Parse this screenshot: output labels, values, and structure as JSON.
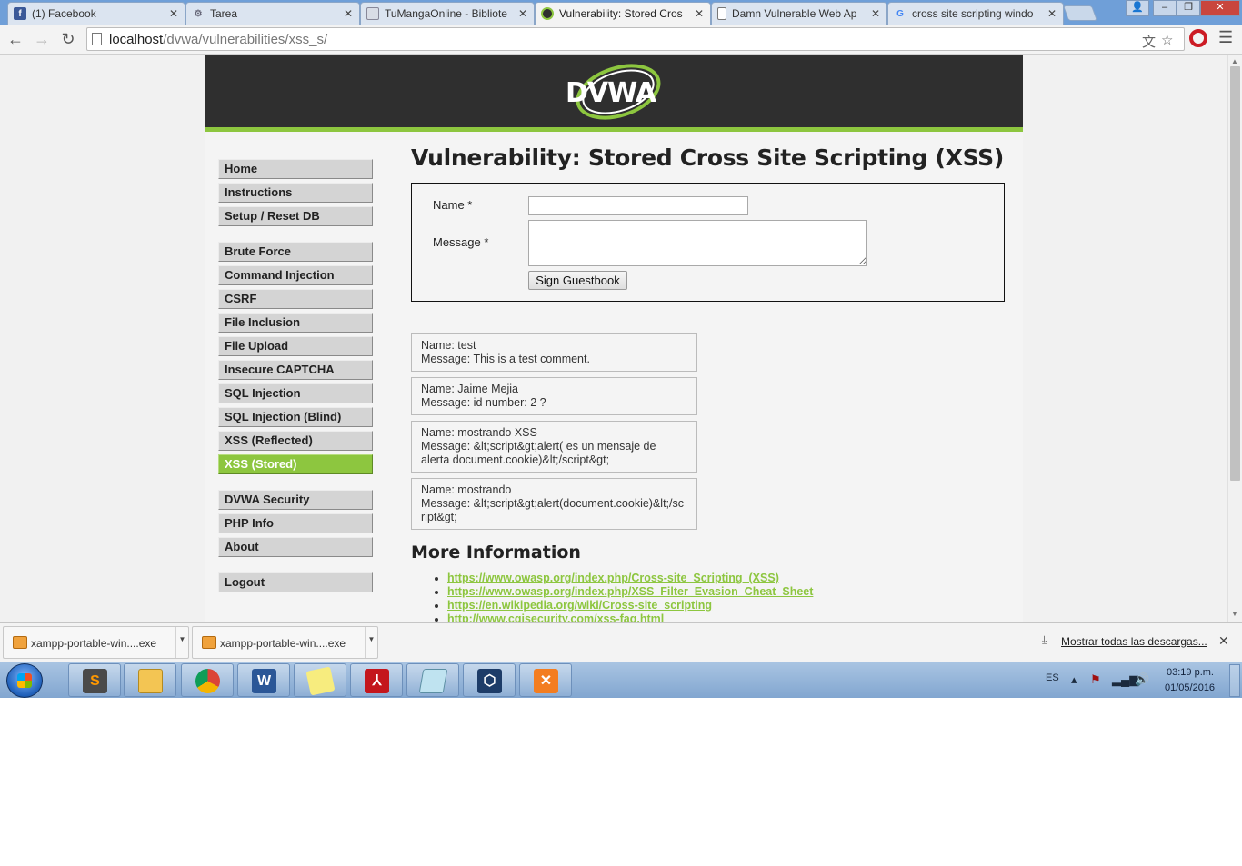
{
  "browser": {
    "tabs": [
      {
        "title": "(1) Facebook",
        "active": false,
        "favicon": "facebook-icon"
      },
      {
        "title": "Tarea",
        "active": false,
        "favicon": "gear-icon"
      },
      {
        "title": "TuMangaOnline - Bibliote",
        "active": false,
        "favicon": "manga-icon"
      },
      {
        "title": "Vulnerability: Stored Cros",
        "active": true,
        "favicon": "dvwa-icon"
      },
      {
        "title": "Damn Vulnerable Web Ap",
        "active": false,
        "favicon": "page-icon"
      },
      {
        "title": "cross site scripting windo",
        "active": false,
        "favicon": "google-icon"
      }
    ],
    "url_host": "localhost",
    "url_path": "/dvwa/vulnerabilities/xss_s/"
  },
  "dvwa": {
    "logo_text": "DVWA",
    "menu": {
      "block1": [
        "Home",
        "Instructions",
        "Setup / Reset DB"
      ],
      "block2": [
        "Brute Force",
        "Command Injection",
        "CSRF",
        "File Inclusion",
        "File Upload",
        "Insecure CAPTCHA",
        "SQL Injection",
        "SQL Injection (Blind)",
        "XSS (Reflected)",
        "XSS (Stored)"
      ],
      "block3": [
        "DVWA Security",
        "PHP Info",
        "About"
      ],
      "block4": [
        "Logout"
      ],
      "selected": "XSS (Stored)"
    },
    "title": "Vulnerability: Stored Cross Site Scripting (XSS)",
    "form": {
      "name_label": "Name *",
      "message_label": "Message *",
      "name_value": "",
      "message_value": "",
      "button_label": "Sign Guestbook"
    },
    "entries": [
      {
        "name": "Name: test",
        "message": "Message: This is a test comment."
      },
      {
        "name": "Name: Jaime Mejia",
        "message": "Message: id number: 2 ?"
      },
      {
        "name": "Name: mostrando XSS",
        "message": "Message: &lt;script&gt;alert( es un mensaje de alerta document.cookie)&lt;/script&gt;"
      },
      {
        "name": "Name: mostrando",
        "message": "Message: &lt;script&gt;alert(document.cookie)&lt;/script&gt;"
      }
    ],
    "more_info": {
      "heading": "More Information",
      "links": [
        "https://www.owasp.org/index.php/Cross-site_Scripting_(XSS)",
        "https://www.owasp.org/index.php/XSS_Filter_Evasion_Cheat_Sheet",
        "https://en.wikipedia.org/wiki/Cross-site_scripting",
        "http://www.cgisecurity.com/xss-faq.html"
      ]
    },
    "accent_color": "#8dc63f"
  },
  "downloads": {
    "items": [
      "xampp-portable-win....exe",
      "xampp-portable-win....exe"
    ],
    "show_all": "Mostrar todas las descargas..."
  },
  "taskbar": {
    "apps": [
      "sublime-text-icon",
      "file-explorer-icon",
      "chrome-icon",
      "word-icon",
      "sticky-notes-icon",
      "acrobat-icon",
      "notepad-icon",
      "virtualbox-icon",
      "xampp-icon"
    ],
    "lang": "ES",
    "time": "03:19 p.m.",
    "date": "01/05/2016"
  }
}
